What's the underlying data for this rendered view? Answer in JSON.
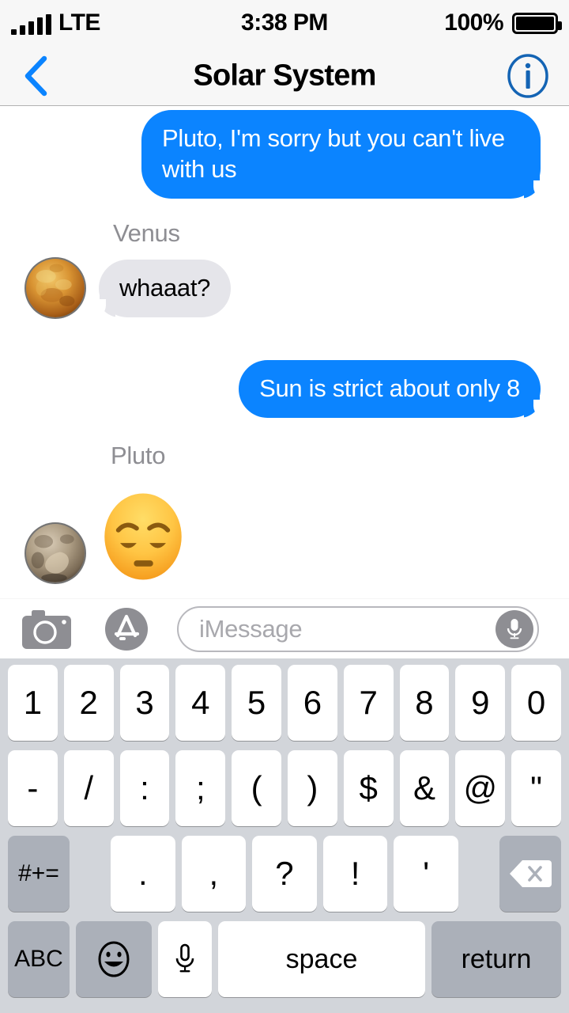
{
  "status_bar": {
    "signal_icon": "cellular-bars-icon",
    "carrier": "LTE",
    "time": "3:38 PM",
    "battery_percent": "100%",
    "battery_icon": "battery-full-icon"
  },
  "nav_bar": {
    "back_icon": "chevron-left-icon",
    "title": "Solar System",
    "info_icon": "info-circle-icon",
    "accent_color": "#0b84ff",
    "background_color": "#f7f7f7"
  },
  "thread": {
    "outgoing_bubble_color": "#0b84ff",
    "incoming_bubble_color": "#e5e5ea",
    "sender_label_color": "#8e8e93",
    "messages": [
      {
        "id": "msg-1",
        "direction": "outgoing",
        "kind": "text",
        "text": "Pluto, I'm sorry but you can't live with us"
      },
      {
        "id": "msg-2",
        "direction": "incoming",
        "kind": "text",
        "sender": "Venus",
        "avatar": "venus-planet-avatar",
        "text": "whaaat?"
      },
      {
        "id": "msg-3",
        "direction": "outgoing",
        "kind": "text",
        "text": "Sun is strict about only 8"
      },
      {
        "id": "msg-4",
        "direction": "incoming",
        "kind": "emoji",
        "sender": "Pluto",
        "avatar": "pluto-planet-avatar",
        "emoji_name": "pensive-face-emoji",
        "text": "😔"
      }
    ]
  },
  "input_bar": {
    "camera_icon": "camera-icon",
    "apps_icon": "app-store-icon",
    "placeholder": "iMessage",
    "value": "",
    "mic_icon": "microphone-icon"
  },
  "keyboard": {
    "layout": "numeric-symbols",
    "background_color": "#d2d5da",
    "key_color": "#ffffff",
    "modifier_key_color": "#abb0b9",
    "row1": [
      "1",
      "2",
      "3",
      "4",
      "5",
      "6",
      "7",
      "8",
      "9",
      "0"
    ],
    "row2": [
      "-",
      "/",
      ":",
      ";",
      "(",
      ")",
      "$",
      "&",
      "@",
      "\""
    ],
    "row3": {
      "shift_label": "#+=",
      "keys": [
        ".",
        ",",
        "?",
        "!",
        "'"
      ],
      "delete_icon": "delete-backspace-icon"
    },
    "row4": {
      "abc_label": "ABC",
      "emoji_icon": "emoji-smiley-icon",
      "dictation_icon": "microphone-icon",
      "space_label": "space",
      "return_label": "return"
    }
  }
}
